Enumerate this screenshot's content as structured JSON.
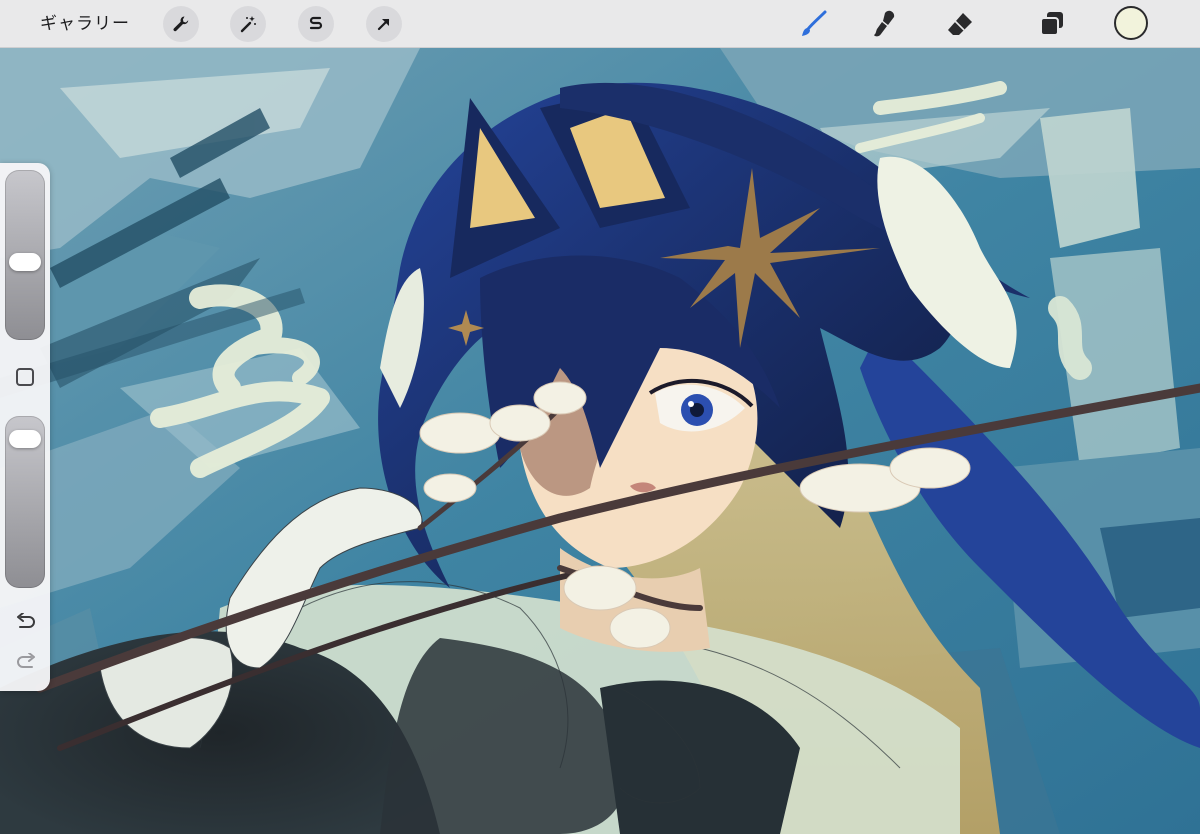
{
  "toolbar": {
    "gallery_label": "ギャラリー",
    "actions": [
      {
        "name": "actions-wrench-icon"
      },
      {
        "name": "adjustments-magic-wand-icon"
      },
      {
        "name": "selection-s-icon"
      },
      {
        "name": "transform-arrow-icon"
      }
    ],
    "tools": [
      {
        "name": "brush-icon",
        "active": true
      },
      {
        "name": "smudge-icon",
        "active": false
      },
      {
        "name": "eraser-icon",
        "active": false
      },
      {
        "name": "layers-icon",
        "active": false
      }
    ],
    "active_tool_color": "#2f6fdb",
    "current_color": "#f2f3dc"
  },
  "sidebar": {
    "brush_size_level": 0.45,
    "opacity_level": 0.07,
    "icons": [
      "modifier-square-icon",
      "undo-icon",
      "redo-icon"
    ]
  },
  "canvas": {
    "palette": {
      "sky": "#3d7f9c",
      "sky_light": "#8fb7c7",
      "cloud": "#eef2dc",
      "hair": "#1b2f6a",
      "hair_light": "#2f57b8",
      "skin": "#f6dfc4",
      "gold": "#e9cd8a",
      "dark": "#1d2126",
      "branch": "#4a3a3a"
    }
  }
}
